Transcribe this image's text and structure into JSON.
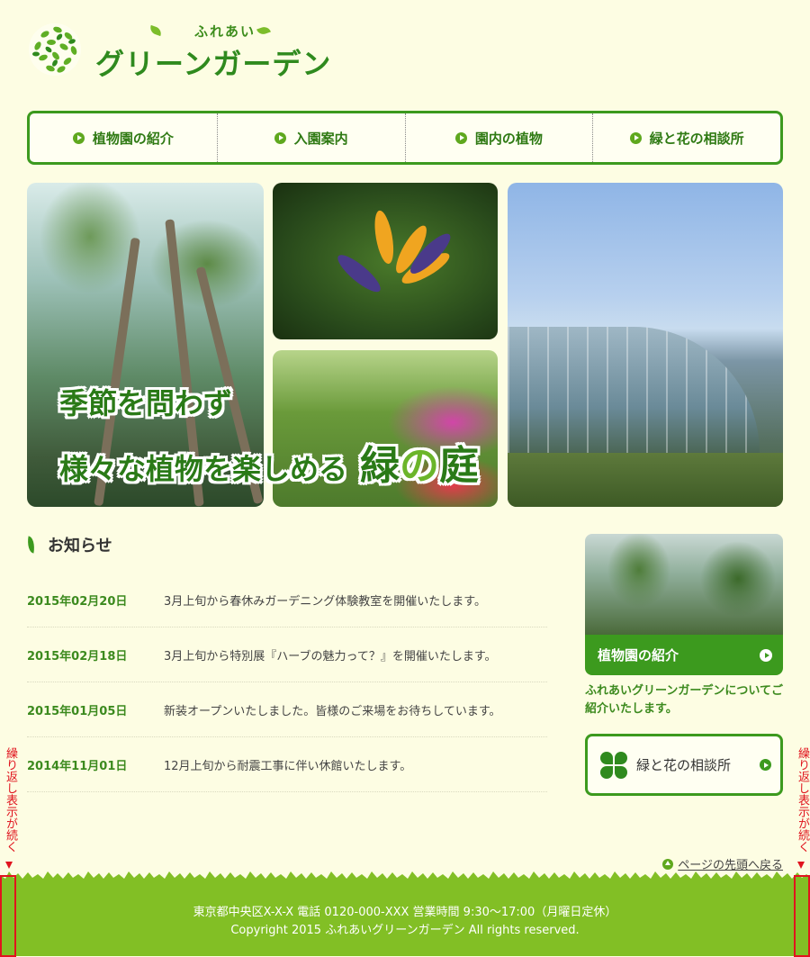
{
  "logo": {
    "subtitle": "ふれあい",
    "title": "グリーンガーデン"
  },
  "gnav": {
    "items": [
      {
        "label": "植物園の紹介"
      },
      {
        "label": "入園案内"
      },
      {
        "label": "園内の植物"
      },
      {
        "label": "緑と花の相談所"
      }
    ]
  },
  "hero": {
    "line1": "季節を問わず",
    "line2": "様々な植物を楽しめる",
    "line2_big_a": "緑",
    "line2_big_b": "の",
    "line2_big_c": "庭"
  },
  "news": {
    "title": "お知らせ",
    "items": [
      {
        "date": "2015年02月20日",
        "text": "3月上旬から春休みガーデニング体験教室を開催いたします。"
      },
      {
        "date": "2015年02月18日",
        "text": "3月上旬から特別展『ハーブの魅力って？』を開催いたします。"
      },
      {
        "date": "2015年01月05日",
        "text": "新装オープンいたしました。皆様のご来場をお待ちしています。"
      },
      {
        "date": "2014年11月01日",
        "text": "12月上旬から耐震工事に伴い休館いたします。"
      }
    ]
  },
  "sidebar": {
    "intro_label": "植物園の紹介",
    "intro_desc": "ふれあいグリーンガーデンについてご紹介いたします。",
    "consult_label": "緑と花の相談所"
  },
  "totop": {
    "label": "ページの先頭へ戻る"
  },
  "footer": {
    "address": "東京都中央区X-X-X 電話 0120-000-XXX 営業時間 9:30～17:00（月曜日定休）",
    "copyright": "Copyright 2015 ふれあいグリーンガーデン All rights reserved."
  },
  "annotation": {
    "repeat": "繰り返し表示が続く"
  },
  "colors": {
    "background": "#fdfde3",
    "green_dark": "#3c9a1e",
    "green_footer": "#82bf25",
    "annotation_red": "#e0141e"
  }
}
